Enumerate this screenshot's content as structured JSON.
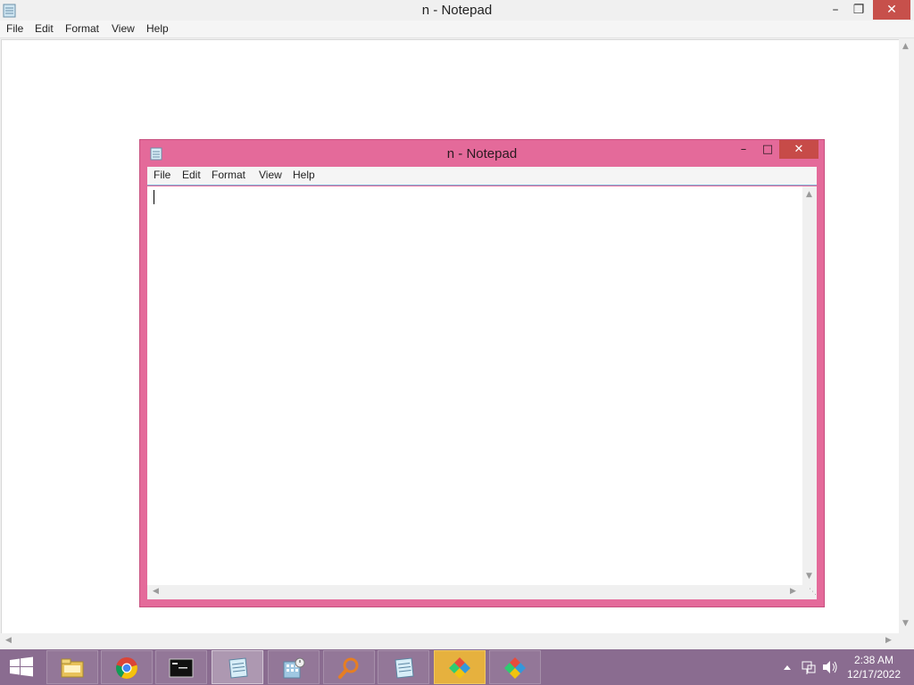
{
  "background_window": {
    "title": "n - Notepad",
    "menu": [
      "File",
      "Edit",
      "Format",
      "View",
      "Help"
    ],
    "controls": {
      "minimize": "–",
      "restore": "❐",
      "close": "✕"
    }
  },
  "foreground_window": {
    "title": "n - Notepad",
    "menu": [
      "File",
      "Edit",
      "Format",
      "View",
      "Help"
    ],
    "controls": {
      "minimize": "–",
      "maximize": "□",
      "close": "✕"
    },
    "frame_color": "#e46a9a",
    "text_content": ""
  },
  "taskbar": {
    "color": "#8a6c90",
    "buttons": [
      {
        "name": "file-explorer-icon"
      },
      {
        "name": "chrome-icon"
      },
      {
        "name": "command-prompt-icon"
      },
      {
        "name": "notepad-icon",
        "active": true
      },
      {
        "name": "calculator-icon"
      },
      {
        "name": "search-magnifier-icon"
      },
      {
        "name": "notepad-icon"
      },
      {
        "name": "app-diamond-icon",
        "highlighted": true
      },
      {
        "name": "app-diamond-icon"
      }
    ],
    "tray_icons": [
      "show-hidden-icons-arrow-icon",
      "network-icon",
      "volume-icon"
    ],
    "time": "2:38 AM",
    "date": "12/17/2022"
  }
}
